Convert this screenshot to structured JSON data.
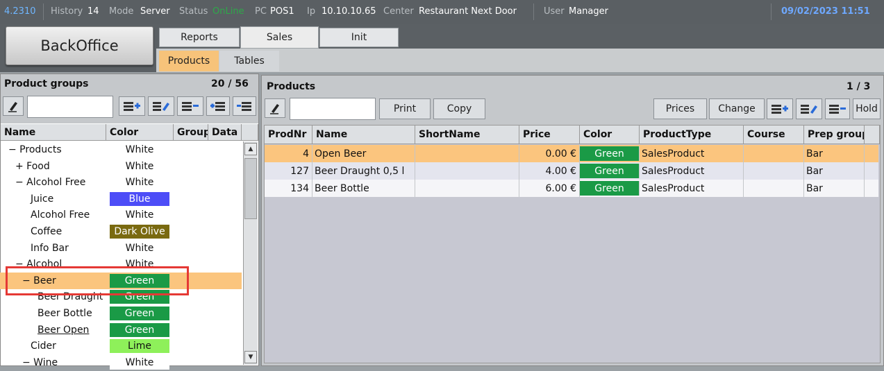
{
  "statusbar": {
    "version": "4.2310",
    "history_label": "History",
    "history_value": "14",
    "mode_label": "Mode",
    "mode_value": "Server",
    "status_label": "Status",
    "status_value": "OnLine",
    "pc_label": "PC",
    "pc_value": "POS1",
    "ip_label": "Ip",
    "ip_value": "10.10.10.65",
    "center_label": "Center",
    "center_value": "Restaurant Next Door",
    "user_label": "User",
    "user_value": "Manager",
    "datetime": "09/02/2023 11:51"
  },
  "nav": {
    "backoffice": "BackOffice",
    "tabs": [
      "Reports",
      "Sales",
      "Init"
    ],
    "subtabs": [
      "Products",
      "Tables"
    ]
  },
  "groups_panel": {
    "title": "Product groups",
    "count": "20 / 56",
    "headers": [
      "Name",
      "Color",
      "Group",
      "Data"
    ],
    "rows": [
      {
        "name": "− Products",
        "color": "White",
        "hex": "#ffffff",
        "fg": "#111111"
      },
      {
        "name": "+ Food",
        "color": "White",
        "hex": "#ffffff",
        "fg": "#111111"
      },
      {
        "name": "− Alcohol Free",
        "color": "White",
        "hex": "#ffffff",
        "fg": "#111111"
      },
      {
        "name": "Juice",
        "color": "Blue",
        "hex": "#4d4df7",
        "fg": "#ffffff"
      },
      {
        "name": "Alcohol Free",
        "color": "White",
        "hex": "#ffffff",
        "fg": "#111111"
      },
      {
        "name": "Coffee",
        "color": "Dark Olive",
        "hex": "#7a6a10",
        "fg": "#ffffff"
      },
      {
        "name": "Info Bar",
        "color": "White",
        "hex": "#ffffff",
        "fg": "#111111"
      },
      {
        "name": "− Alcohol",
        "color": "White",
        "hex": "#ffffff",
        "fg": "#111111"
      },
      {
        "name": "− Beer",
        "color": "Green",
        "hex": "#1a9a46",
        "fg": "#ffffff"
      },
      {
        "name": "Beer Draught",
        "color": "Green",
        "hex": "#1a9a46",
        "fg": "#ffffff"
      },
      {
        "name": "Beer Bottle",
        "color": "Green",
        "hex": "#1a9a46",
        "fg": "#ffffff"
      },
      {
        "name": "Beer Open",
        "color": "Green",
        "hex": "#1a9a46",
        "fg": "#ffffff"
      },
      {
        "name": "Cider",
        "color": "Lime",
        "hex": "#8ef05a",
        "fg": "#111111"
      },
      {
        "name": "− Wine",
        "color": "White",
        "hex": "#ffffff",
        "fg": "#111111"
      }
    ]
  },
  "products_panel": {
    "title": "Products",
    "count": "1 / 3",
    "buttons": {
      "print": "Print",
      "copy": "Copy",
      "prices": "Prices",
      "change": "Change",
      "hold": "Hold"
    },
    "headers": [
      "ProdNr",
      "Name",
      "ShortName",
      "Price",
      "Color",
      "ProductType",
      "Course",
      "Prep group"
    ],
    "rows": [
      {
        "nr": "4",
        "name": "Open Beer",
        "short": "",
        "price": "0.00 €",
        "color": "Green",
        "type": "SalesProduct",
        "course": "",
        "prep": "Bar"
      },
      {
        "nr": "127",
        "name": "Beer Draught 0,5 l",
        "short": "",
        "price": "4.00 €",
        "color": "Green",
        "type": "SalesProduct",
        "course": "",
        "prep": "Bar"
      },
      {
        "nr": "134",
        "name": "Beer Bottle",
        "short": "",
        "price": "6.00 €",
        "color": "Green",
        "type": "SalesProduct",
        "course": "",
        "prep": "Bar"
      }
    ]
  },
  "colors": {
    "selected_row": "#fbc57e",
    "green": "#1a9a46",
    "highlight": "#e53935"
  }
}
